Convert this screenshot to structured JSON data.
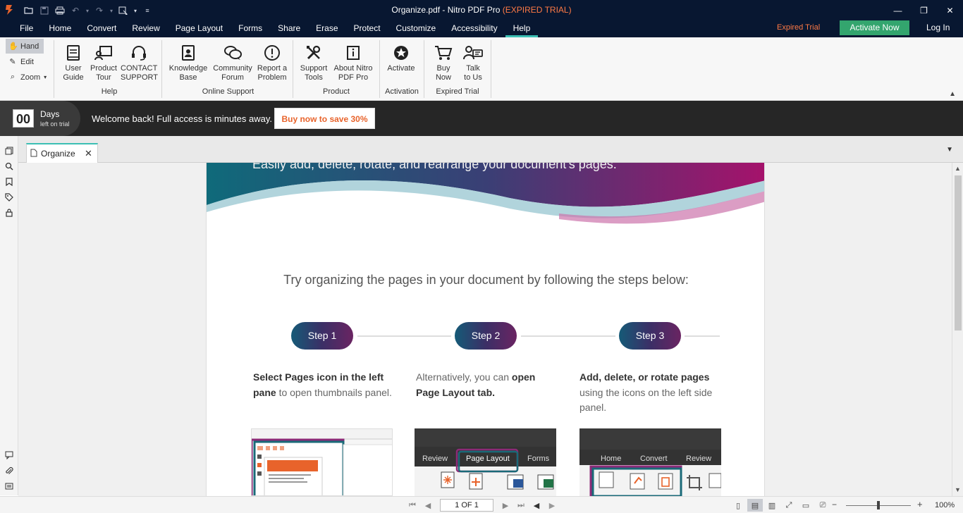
{
  "titlebar": {
    "title": "Organize.pdf - Nitro PDF Pro",
    "trial_tag": "(EXPIRED TRIAL)",
    "quick_access_icons": [
      "open-folder-icon",
      "save-icon",
      "print-icon",
      "undo-icon",
      "redo-icon",
      "select-tool-icon",
      "customize-qat-icon"
    ]
  },
  "menubar": {
    "tabs": [
      {
        "label": "File"
      },
      {
        "label": "Home"
      },
      {
        "label": "Convert"
      },
      {
        "label": "Review"
      },
      {
        "label": "Page Layout"
      },
      {
        "label": "Forms"
      },
      {
        "label": "Share"
      },
      {
        "label": "Erase"
      },
      {
        "label": "Protect"
      },
      {
        "label": "Customize"
      },
      {
        "label": "Accessibility"
      },
      {
        "label": "Help"
      }
    ],
    "active_tab": "Help",
    "expired_trial": "Expired Trial",
    "activate_now": "Activate Now",
    "login": "Log In",
    "accent_color": "#3cbfb4",
    "activate_color": "#33a56e"
  },
  "ribbon": {
    "modes": [
      {
        "label": "Hand",
        "icon": "hand-icon"
      },
      {
        "label": "Edit",
        "icon": "edit-icon"
      },
      {
        "label": "Zoom",
        "icon": "zoom-icon"
      }
    ],
    "help_group": {
      "label": "Help",
      "buttons": [
        {
          "line1": "User",
          "line2": "Guide",
          "icon": "book-icon"
        },
        {
          "line1": "Product",
          "line2": "Tour",
          "icon": "tour-icon"
        },
        {
          "line1": "CONTACT",
          "line2": "SUPPORT",
          "icon": "headset-icon"
        }
      ]
    },
    "online_group": {
      "label": "Online Support",
      "buttons": [
        {
          "line1": "Knowledge",
          "line2": "Base",
          "icon": "knowledge-icon"
        },
        {
          "line1": "Community",
          "line2": "Forum",
          "icon": "forum-icon"
        },
        {
          "line1": "Report a",
          "line2": "Problem",
          "icon": "alert-icon"
        }
      ]
    },
    "product_group": {
      "label": "Product",
      "buttons": [
        {
          "line1": "Support",
          "line2": "Tools",
          "icon": "tools-icon"
        },
        {
          "line1": "About Nitro",
          "line2": "PDF Pro",
          "icon": "info-icon"
        }
      ]
    },
    "activation_group": {
      "label": "Activation",
      "buttons": [
        {
          "line1": "Activate",
          "line2": "",
          "icon": "star-badge-icon"
        }
      ]
    },
    "trial_group": {
      "label": "Expired Trial",
      "buttons": [
        {
          "line1": "Buy",
          "line2": "Now",
          "icon": "cart-icon"
        },
        {
          "line1": "Talk",
          "line2": "to Us",
          "icon": "chat-person-icon"
        }
      ]
    }
  },
  "trialbar": {
    "days_number": "00",
    "days_label": "Days",
    "days_sub": "left on trial",
    "welcome": "Welcome back! Full access is minutes away.",
    "buy_button": "Buy now to save 30%",
    "buy_color": "#e8632b"
  },
  "leftrail": {
    "top_icons": [
      "pages-icon",
      "search-icon",
      "bookmark-icon",
      "tag-icon",
      "lock-icon"
    ],
    "bottom_icons": [
      "comment-icon",
      "attachment-icon",
      "form-fields-icon"
    ]
  },
  "doctab": {
    "label": "Organize"
  },
  "page": {
    "hero_text": "Easily add, delete, rotate, and rearrange your document's pages.",
    "intro": "Try organizing the pages in your document by following the steps below:",
    "steps": [
      {
        "label": "Step 1",
        "bold1": "Select Pages icon in the left pane",
        "rest1": " to open thumbnails panel.",
        "pre": "",
        "bold2": ""
      },
      {
        "label": "Step 2",
        "pre": "Alternatively, you can ",
        "bold1": "open Page Layout tab.",
        "rest1": "",
        "bold2": ""
      },
      {
        "label": "Step 3",
        "bold1": "Add, delete, or rotate pages",
        "rest1": " using the icons on the left side panel.",
        "pre": "",
        "bold2": ""
      }
    ],
    "thumb2_tabs": [
      "Review",
      "Page Layout",
      "Forms"
    ],
    "thumb3_tabs": [
      "Home",
      "Convert",
      "Review"
    ],
    "hero_colors": [
      "#0f6a7a",
      "#3a3f75",
      "#a5126b"
    ]
  },
  "statusbar": {
    "page_indicator": "1 OF 1",
    "zoom": "100%",
    "zoom_fraction": 0.5
  }
}
